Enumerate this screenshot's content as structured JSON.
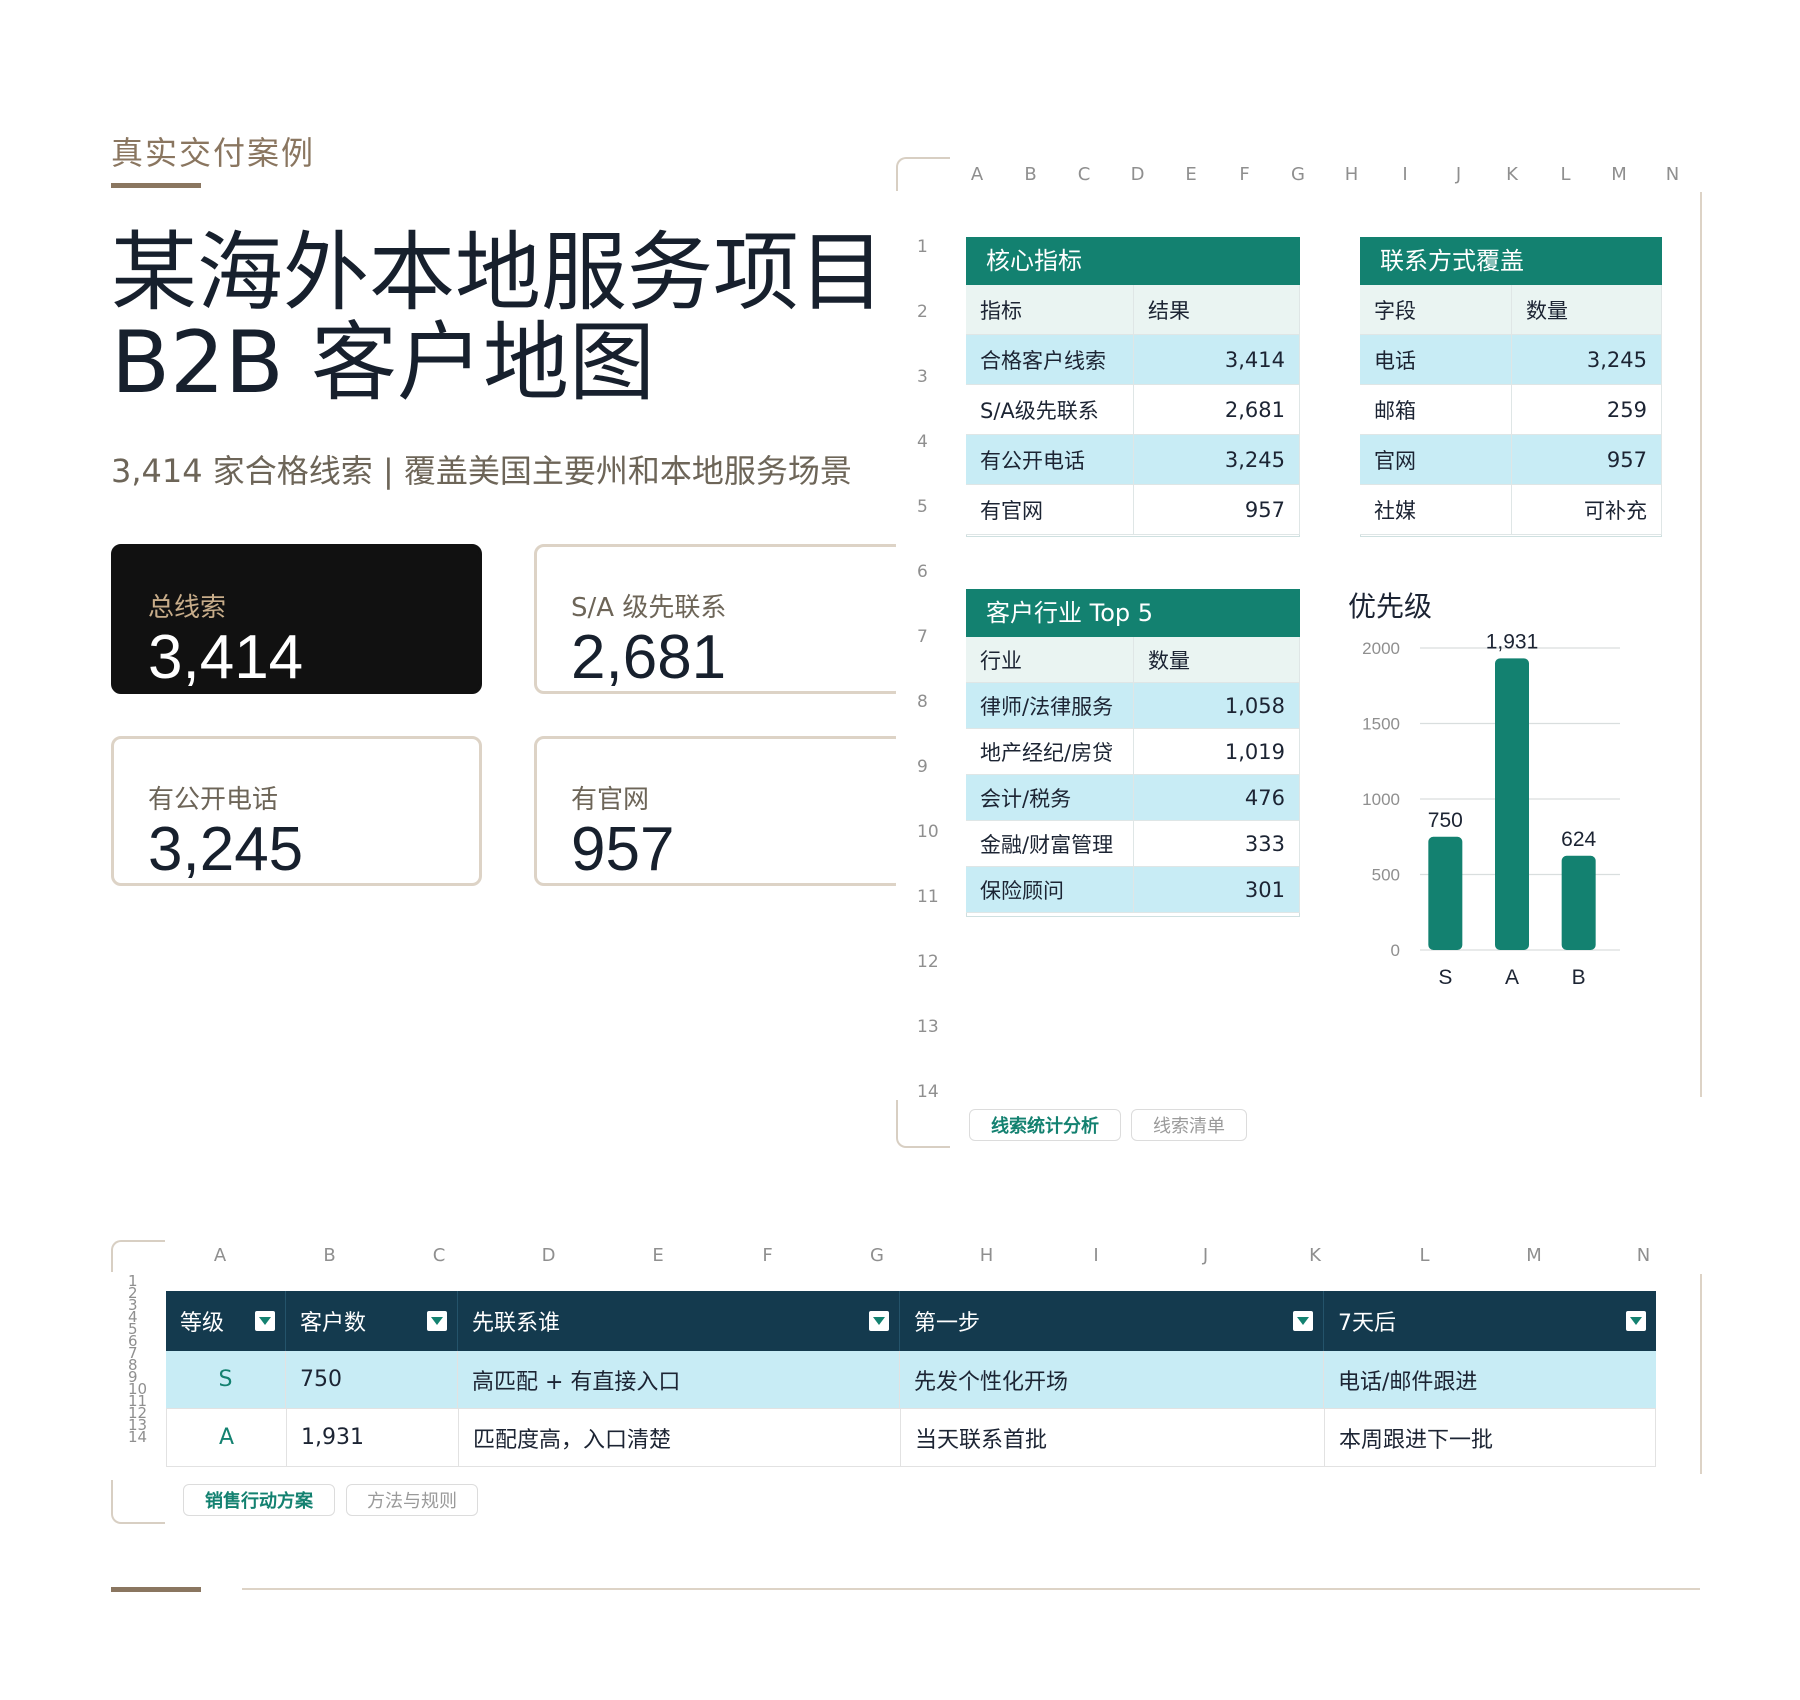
{
  "header": {
    "eyebrow": "真实交付案例",
    "title_line1": "某海外本地服务项目",
    "title_line2": "B2B 客户地图",
    "subtitle": "3,414 家合格线索 | 覆盖美国主要州和本地服务场景"
  },
  "cards": [
    {
      "label": "总线索",
      "value": "3,414"
    },
    {
      "label": "S/A 级先联系",
      "value": "2,681"
    },
    {
      "label": "有公开电话",
      "value": "3,245"
    },
    {
      "label": "有官网",
      "value": "957"
    }
  ],
  "sheet1": {
    "columns": [
      "A",
      "B",
      "C",
      "D",
      "E",
      "F",
      "G",
      "H",
      "I",
      "J",
      "K",
      "L",
      "M",
      "N"
    ],
    "rows": [
      "1",
      "2",
      "3",
      "4",
      "5",
      "6",
      "7",
      "8",
      "9",
      "10",
      "11",
      "12",
      "13",
      "14"
    ],
    "core": {
      "title": "核心指标",
      "headers": [
        "指标",
        "结果"
      ],
      "rows": [
        [
          "合格客户线索",
          "3,414"
        ],
        [
          "S/A级先联系",
          "2,681"
        ],
        [
          "有公开电话",
          "3,245"
        ],
        [
          "有官网",
          "957"
        ]
      ]
    },
    "contact": {
      "title": "联系方式覆盖",
      "headers": [
        "字段",
        "数量"
      ],
      "rows": [
        [
          "电话",
          "3,245"
        ],
        [
          "邮箱",
          "259"
        ],
        [
          "官网",
          "957"
        ],
        [
          "社媒",
          "可补充"
        ]
      ]
    },
    "industry": {
      "title": "客户行业 Top 5",
      "headers": [
        "行业",
        "数量"
      ],
      "rows": [
        [
          "律师/法律服务",
          "1,058"
        ],
        [
          "地产经纪/房贷",
          "1,019"
        ],
        [
          "会计/税务",
          "476"
        ],
        [
          "金融/财富管理",
          "333"
        ],
        [
          "保险顾问",
          "301"
        ]
      ]
    },
    "tabs": [
      "线索统计分析",
      "线索清单"
    ]
  },
  "chart_data": {
    "type": "bar",
    "title": "优先级",
    "categories": [
      "S",
      "A",
      "B"
    ],
    "values": [
      750,
      1931,
      624
    ],
    "value_labels": [
      "750",
      "1,931",
      "624"
    ],
    "ylim": [
      0,
      2000
    ],
    "yticks": [
      "2000",
      "1500",
      "1000",
      "500",
      "0"
    ],
    "grid": true,
    "color": "#138170"
  },
  "sheet2": {
    "columns": [
      "A",
      "B",
      "C",
      "D",
      "E",
      "F",
      "G",
      "H",
      "I",
      "J",
      "K",
      "L",
      "M",
      "N"
    ],
    "rows": [
      "1",
      "2",
      "3",
      "4",
      "5",
      "6",
      "7",
      "8",
      "9",
      "10",
      "11",
      "12",
      "13",
      "14"
    ],
    "headers": [
      "等级",
      "客户数",
      "先联系谁",
      "第一步",
      "7天后"
    ],
    "rows_data": [
      [
        "S",
        "750",
        "高匹配 + 有直接入口",
        "先发个性化开场",
        "电话/邮件跟进"
      ],
      [
        "A",
        "1,931",
        "匹配度高，入口清楚",
        "当天联系首批",
        "本周跟进下一批"
      ]
    ],
    "tabs": [
      "销售行动方案",
      "方法与规则"
    ]
  },
  "colors": {
    "teal": "#138170",
    "navy": "#143a4e",
    "gold": "#8a7660",
    "light_blue": "#c8ecf5"
  }
}
